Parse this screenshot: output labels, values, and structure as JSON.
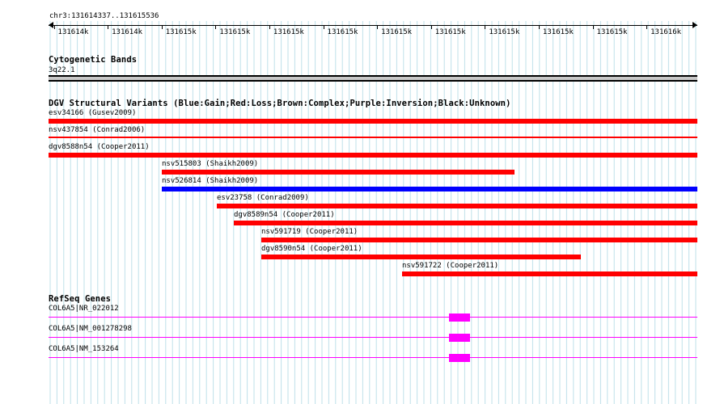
{
  "browser": {
    "coordinates": "chr3:131614337..131615536",
    "ruler_ticks": [
      "131614k",
      "131614k",
      "131615k",
      "131615k",
      "131615k",
      "131615k",
      "131615k",
      "131615k",
      "131615k",
      "131615k",
      "131615k",
      "131616k"
    ]
  },
  "cytoband": {
    "title": "Cytogenetic Bands",
    "band_label": "3q22.1"
  },
  "dgv": {
    "title": "DGV Structural Variants (Blue:Gain;Red:Loss;Brown:Complex;Purple:Inversion;Black:Unknown)",
    "colors": {
      "loss": "#ff0000",
      "gain": "#0000ff"
    },
    "variants": [
      {
        "label": "esv34166 (Gusev2009)",
        "type": "loss"
      },
      {
        "label": "nsv437854 (Conrad2006)",
        "type": "loss"
      },
      {
        "label": "dgv8588n54 (Cooper2011)",
        "type": "loss"
      },
      {
        "label": "nsv515803 (Shaikh2009)",
        "type": "loss"
      },
      {
        "label": "nsv526814 (Shaikh2009)",
        "type": "gain"
      },
      {
        "label": "esv23758 (Conrad2009)",
        "type": "loss"
      },
      {
        "label": "dgv8589n54 (Cooper2011)",
        "type": "loss"
      },
      {
        "label": "nsv591719 (Cooper2011)",
        "type": "loss"
      },
      {
        "label": "dgv8590n54 (Cooper2011)",
        "type": "loss"
      },
      {
        "label": "nsv591722 (Cooper2011)",
        "type": "loss"
      }
    ]
  },
  "refseq": {
    "title": "RefSeq Genes",
    "color": "#ff00ff",
    "genes": [
      {
        "label": "COL6A5|NR_022012"
      },
      {
        "label": "COL6A5|NM_001278298"
      },
      {
        "label": "COL6A5|NM_153264"
      }
    ]
  }
}
